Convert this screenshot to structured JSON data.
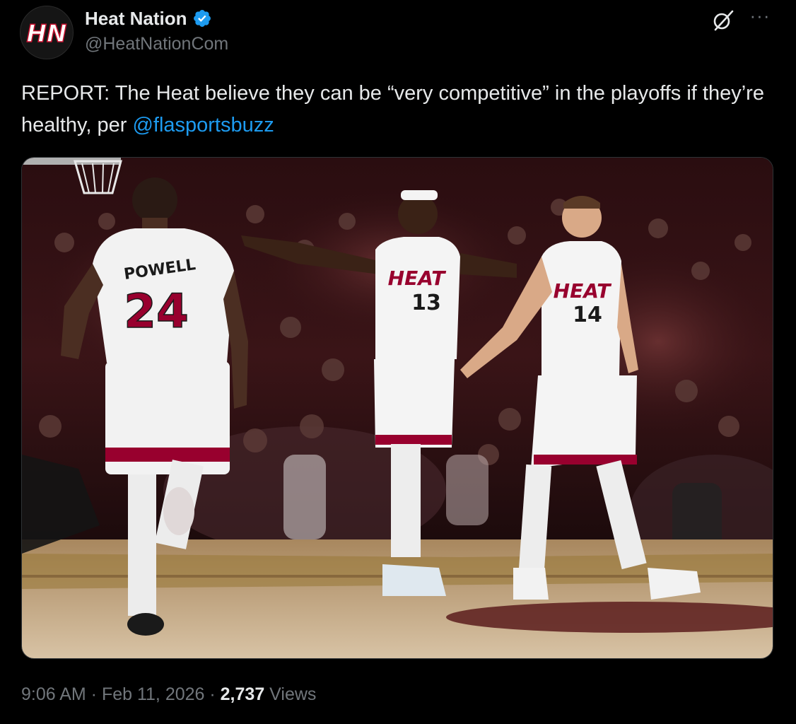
{
  "account": {
    "display_name": "Heat Nation",
    "handle": "@HeatNationCom",
    "avatar_logo_text": "HN",
    "verified_icon": "verified-badge-icon"
  },
  "actions": {
    "grok_icon": "grok-icon",
    "more_icon": "more-options-icon",
    "more_glyph": "···"
  },
  "tweet": {
    "text_before": "REPORT: The Heat believe they can be “very competitive” in the playoffs if they’re healthy, per ",
    "mention": "@flasportsbuzz"
  },
  "media": {
    "jersey_names": [
      "POWELL"
    ],
    "jersey_numbers": [
      "24",
      "13",
      "14"
    ],
    "jersey_team_text": "HEAT"
  },
  "meta": {
    "time": "9:06 AM",
    "separator": " · ",
    "date": "Feb 11, 2026",
    "views_count": "2,737",
    "views_label": " Views"
  },
  "colors": {
    "background": "#000000",
    "text": "#e7e9ea",
    "secondary": "#71767b",
    "link": "#1d9bf0",
    "heat_red": "#98002e"
  }
}
